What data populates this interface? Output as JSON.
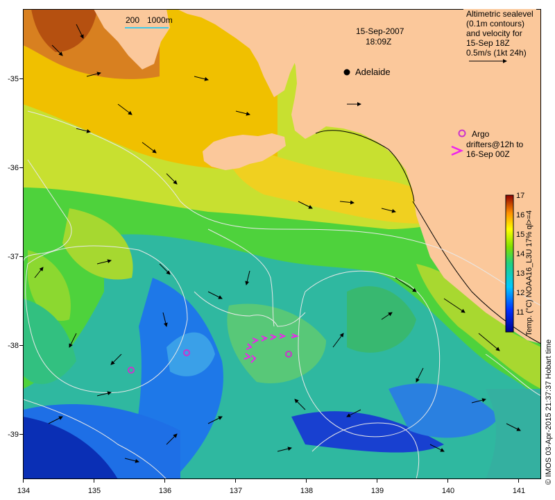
{
  "map": {
    "date": "15-Sep-2007",
    "time": "18:09Z",
    "city": "Adelaide",
    "bathy_label_1": "200",
    "bathy_label_2": "1000m",
    "legend_lines": [
      "Altimetric sealevel",
      "(0.1m contours)",
      "and velocity for",
      "15-Sep 18Z",
      "0.5m/s (1kt 24h)"
    ],
    "argo_label": "Argo",
    "drifter_lines": [
      "drifters@12h to",
      "16-Sep 00Z"
    ],
    "colorbar_title": "Temp. (°C) NOAA16_L3U 17% ql>=4",
    "colorbar_ticks": [
      "17",
      "16",
      "15",
      "14",
      "13",
      "12",
      "11"
    ],
    "credit": "© IMOS 03-Apr-2015 21:37:37 Hobart time",
    "x_ticks": [
      "134",
      "135",
      "136",
      "137",
      "138",
      "139",
      "140",
      "141"
    ],
    "y_ticks": [
      "-35",
      "-36",
      "-37",
      "-38",
      "-39"
    ],
    "colors": {
      "land": "#fbc89b",
      "contour": "#e0e0e0",
      "argo": "#cc33cc",
      "drifter": "#ee22ee"
    },
    "icons": [
      "city-marker-icon",
      "argo-float-icon",
      "drifter-arrow-icon",
      "velocity-arrow-icon"
    ]
  }
}
